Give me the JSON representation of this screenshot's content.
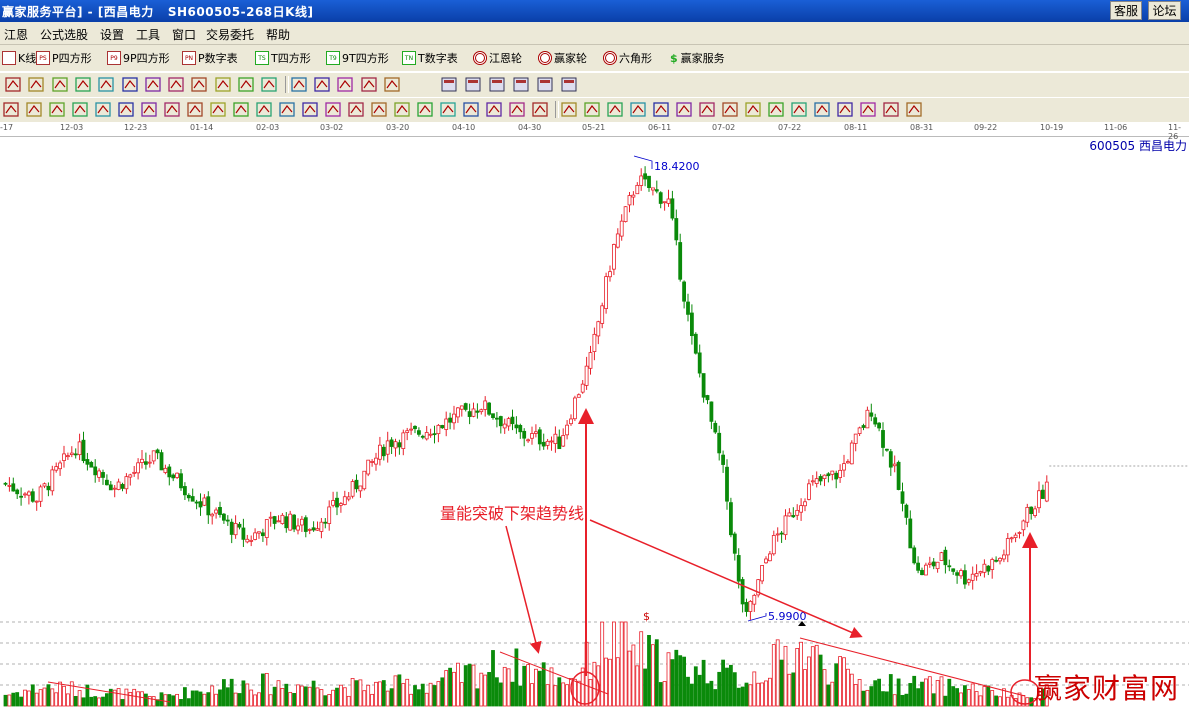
{
  "window": {
    "title": "赢家服务平台] - [西昌电力   SH600505-268日K线]",
    "btn_service": "客服",
    "btn_forum": "论坛"
  },
  "menu": [
    "江恩",
    "公式选股",
    "设置",
    "工具",
    "窗口",
    "交易委托",
    "帮助"
  ],
  "toolbar1": [
    {
      "icon": "PS",
      "label": "K线"
    },
    {
      "icon": "PS",
      "label": "P四方形"
    },
    {
      "icon": "P9",
      "label": "9P四方形"
    },
    {
      "icon": "PN",
      "label": "P数字表"
    },
    {
      "icon": "TS",
      "label": "T四方形"
    },
    {
      "icon": "T9",
      "label": "9T四方形"
    },
    {
      "icon": "TN",
      "label": "T数字表"
    },
    {
      "icon": "wheel",
      "label": "江恩轮"
    },
    {
      "icon": "wheel",
      "label": "赢家轮"
    },
    {
      "icon": "wheel",
      "label": "六角形"
    },
    {
      "icon": "dollar",
      "label": "赢家服务"
    }
  ],
  "date_axis": [
    "-17",
    "12-03",
    "12-23",
    "01-14",
    "02-03",
    "03-02",
    "03-20",
    "04-10",
    "04-30",
    "05-21",
    "06-11",
    "07-02",
    "07-22",
    "08-11",
    "08-31",
    "09-22",
    "10-19",
    "11-06",
    "11-26"
  ],
  "stock_label": "600505 西昌电力",
  "annotation": "量能突破下架趋势线",
  "watermark": "赢家财富网",
  "chart_data": {
    "type": "candlestick",
    "symbol": "SH600505",
    "name": "西昌电力",
    "period": "268日K线",
    "high_label": "18.4200",
    "low_label": "5.9900",
    "marker": "$",
    "price_keypoints": [
      {
        "i": 0,
        "p": 9.7
      },
      {
        "i": 8,
        "p": 9.3
      },
      {
        "i": 18,
        "p": 10.7
      },
      {
        "i": 28,
        "p": 9.6
      },
      {
        "i": 38,
        "p": 10.4
      },
      {
        "i": 50,
        "p": 9.2
      },
      {
        "i": 62,
        "p": 8.2
      },
      {
        "i": 70,
        "p": 8.8
      },
      {
        "i": 78,
        "p": 8.5
      },
      {
        "i": 88,
        "p": 9.4
      },
      {
        "i": 98,
        "p": 10.8
      },
      {
        "i": 110,
        "p": 11.2
      },
      {
        "i": 122,
        "p": 11.8
      },
      {
        "i": 132,
        "p": 11.0
      },
      {
        "i": 142,
        "p": 10.8
      },
      {
        "i": 150,
        "p": 13.0
      },
      {
        "i": 156,
        "p": 16.0
      },
      {
        "i": 162,
        "p": 17.8
      },
      {
        "i": 170,
        "p": 17.2
      },
      {
        "i": 176,
        "p": 13.5
      },
      {
        "i": 184,
        "p": 10.0
      },
      {
        "i": 188,
        "p": 7.0
      },
      {
        "i": 190,
        "p": 6.1
      },
      {
        "i": 196,
        "p": 8.0
      },
      {
        "i": 206,
        "p": 9.6
      },
      {
        "i": 214,
        "p": 10.0
      },
      {
        "i": 222,
        "p": 11.7
      },
      {
        "i": 228,
        "p": 10.0
      },
      {
        "i": 234,
        "p": 7.3
      },
      {
        "i": 240,
        "p": 7.7
      },
      {
        "i": 246,
        "p": 7.2
      },
      {
        "i": 255,
        "p": 7.7
      },
      {
        "i": 262,
        "p": 8.9
      },
      {
        "i": 267,
        "p": 9.6
      }
    ],
    "volume_keypoints": [
      {
        "i": 0,
        "v": 0.15
      },
      {
        "i": 10,
        "v": 0.25
      },
      {
        "i": 40,
        "v": 0.12
      },
      {
        "i": 60,
        "v": 0.3
      },
      {
        "i": 90,
        "v": 0.25
      },
      {
        "i": 110,
        "v": 0.3
      },
      {
        "i": 128,
        "v": 0.55
      },
      {
        "i": 145,
        "v": 0.35
      },
      {
        "i": 155,
        "v": 0.9
      },
      {
        "i": 162,
        "v": 0.7
      },
      {
        "i": 175,
        "v": 0.5
      },
      {
        "i": 190,
        "v": 0.35
      },
      {
        "i": 203,
        "v": 0.75
      },
      {
        "i": 220,
        "v": 0.3
      },
      {
        "i": 245,
        "v": 0.25
      },
      {
        "i": 262,
        "v": 0.1
      },
      {
        "i": 267,
        "v": 0.25
      }
    ]
  },
  "colors": {
    "up": "#e8202a",
    "down": "#0a8a0a",
    "annotation": "#e8202a",
    "label_blue": "#0000cc"
  }
}
